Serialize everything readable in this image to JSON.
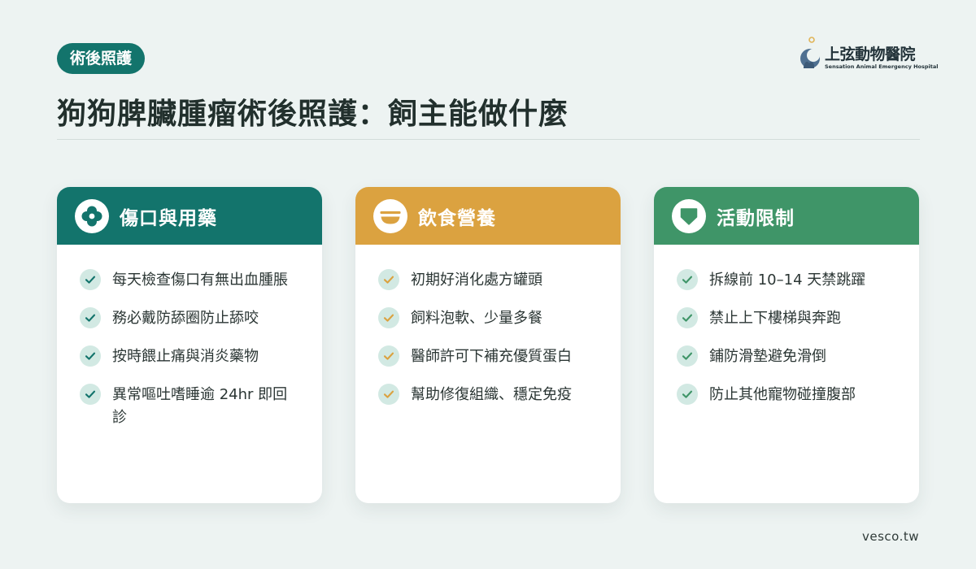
{
  "header": {
    "tag": "術後照護",
    "title": "狗狗脾臟腫瘤術後照護：飼主能做什麼"
  },
  "logo": {
    "name": "上弦動物醫院",
    "subtitle": "Sensation Animal Emergency Hospital"
  },
  "cards": [
    {
      "title": "傷口與用藥",
      "icon": "clover-icon",
      "color": "#13746c",
      "check_color": "#13746c",
      "items": [
        "每天檢查傷口有無出血腫脹",
        "務必戴防舔圈防止舔咬",
        "按時餵止痛與消炎藥物",
        "異常嘔吐嗜睡逾 24hr 即回診"
      ]
    },
    {
      "title": "飲食營養",
      "icon": "bowl-icon",
      "color": "#dba240",
      "check_color": "#dba240",
      "items": [
        "初期好消化處方罐頭",
        "飼料泡軟、少量多餐",
        "醫師許可下補充優質蛋白",
        "幫助修復組織、穩定免疫"
      ]
    },
    {
      "title": "活動限制",
      "icon": "shield-icon",
      "color": "#3f9568",
      "check_color": "#3f9568",
      "items": [
        "拆線前 10–14 天禁跳躍",
        "禁止上下樓梯與奔跑",
        "鋪防滑墊避免滑倒",
        "防止其他寵物碰撞腹部"
      ]
    }
  ],
  "footer": {
    "site": "vesco.tw"
  }
}
